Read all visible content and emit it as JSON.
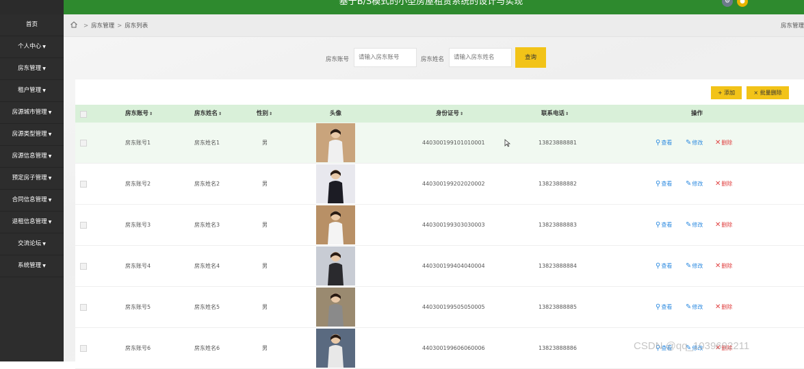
{
  "header": {
    "title": "基于B/S模式的小型房屋租赁系统的设计与实现"
  },
  "sidebar": {
    "items": [
      {
        "label": "首页",
        "caret": ""
      },
      {
        "label": "个人中心",
        "caret": "▼"
      },
      {
        "label": "房东管理",
        "caret": "▼"
      },
      {
        "label": "租户管理",
        "caret": "▼"
      },
      {
        "label": "房源城市管理",
        "caret": "▼"
      },
      {
        "label": "房源类型管理",
        "caret": "▼"
      },
      {
        "label": "房源信息管理",
        "caret": "▼"
      },
      {
        "label": "预定房子管理",
        "caret": "▼"
      },
      {
        "label": "合同信息管理",
        "caret": "▼"
      },
      {
        "label": "退租信息管理",
        "caret": "▼"
      },
      {
        "label": "交流论坛",
        "caret": "▼"
      },
      {
        "label": "系统管理",
        "caret": "▼"
      }
    ]
  },
  "breadcrumb": {
    "level1": "房东管理",
    "level2": "房东列表",
    "separator": ">",
    "right": "房东管理"
  },
  "search": {
    "account_label": "房东账号",
    "account_placeholder": "请输入房东账号",
    "name_label": "房东姓名",
    "name_placeholder": "请输入房东姓名",
    "query_label": "查询"
  },
  "toolbar": {
    "add_label": "添加",
    "add_icon": "+",
    "batch_delete_label": "批量删除",
    "batch_delete_icon": "×"
  },
  "table": {
    "columns": {
      "account": "房东账号",
      "name": "房东姓名",
      "gender": "性别",
      "avatar": "头像",
      "id_number": "身份证号",
      "phone": "联系电话",
      "actions": "操作"
    },
    "sort_icon": "⇕",
    "actions": {
      "view": "查看",
      "edit": "修改",
      "delete": "删除"
    },
    "rows": [
      {
        "account": "房东账号1",
        "name": "房东姓名1",
        "gender": "男",
        "id_number": "440300199101010001",
        "phone": "13823888881",
        "photo_bg": "#c9a47c",
        "photo_clothes": "#f0f0f0"
      },
      {
        "account": "房东账号2",
        "name": "房东姓名2",
        "gender": "男",
        "id_number": "440300199202020002",
        "phone": "13823888882",
        "photo_bg": "#e8e8ee",
        "photo_clothes": "#1c1c24"
      },
      {
        "account": "房东账号3",
        "name": "房东姓名3",
        "gender": "男",
        "id_number": "440300199303030003",
        "phone": "13823888883",
        "photo_bg": "#b89066",
        "photo_clothes": "#f4f4f4"
      },
      {
        "account": "房东账号4",
        "name": "房东姓名4",
        "gender": "男",
        "id_number": "440300199404040004",
        "phone": "13823888884",
        "photo_bg": "#c8ccd4",
        "photo_clothes": "#2a2a2e"
      },
      {
        "account": "房东账号5",
        "name": "房东姓名5",
        "gender": "男",
        "id_number": "440300199505050005",
        "phone": "13823888885",
        "photo_bg": "#9a8a70",
        "photo_clothes": "#8a8a8a"
      },
      {
        "account": "房东账号6",
        "name": "房东姓名6",
        "gender": "男",
        "id_number": "440300199606060006",
        "phone": "13823888886",
        "photo_bg": "#5a6a80",
        "photo_clothes": "#e8e8e8"
      }
    ]
  },
  "watermark": "CSDN @qq_1039692211",
  "colors": {
    "topbar": "#2e8a2e",
    "sidebar": "#2d2d2d",
    "accent_button": "#f2c318",
    "table_header": "#d9f0d9",
    "link_blue": "#2e8be0",
    "delete_red": "#e04040"
  }
}
